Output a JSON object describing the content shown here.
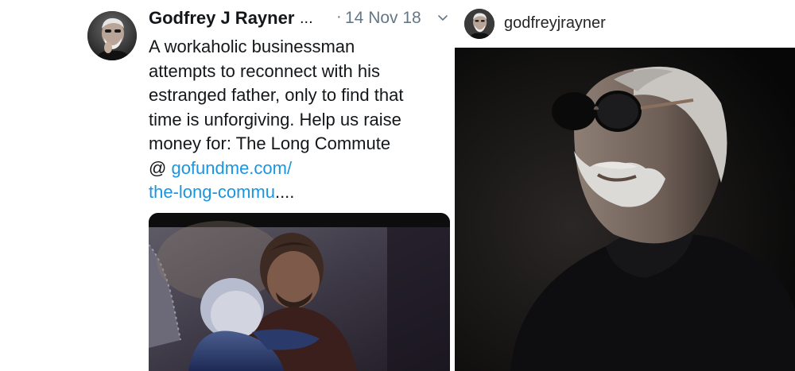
{
  "tweet": {
    "author_name": "Godfrey J Rayner",
    "truncation": "...",
    "separator": "·",
    "date": "14 Nov 18",
    "avatar_icon": "profile-photo-bearded-man",
    "menu_icon": "chevron-down-icon",
    "text_lines": [
      "A workaholic businessman",
      "attempts to reconnect with his",
      "estranged father, only to find that",
      "time is unforgiving. Help us raise",
      "money for: The Long Commute"
    ],
    "link_prefix": "@ ",
    "link_line1": "gofundme.com/",
    "link_line2": "the-long-commu",
    "link_suffix": "....",
    "link_color": "#1b95e0",
    "media_description_icon": "video-still-father-son-hug"
  },
  "instagram": {
    "username": "godfreyjrayner",
    "avatar_icon": "profile-photo-bearded-man",
    "media_icon": "photo-man-in-sunglasses-black-turtleneck"
  }
}
